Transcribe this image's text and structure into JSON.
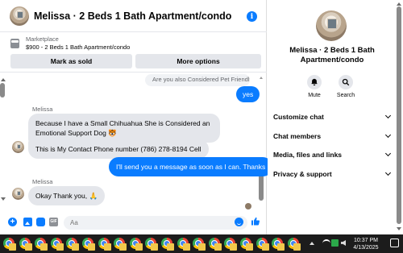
{
  "header": {
    "title": "Melissa · 2 Beds 1 Bath Apartment/condo",
    "info_icon_glyph": "i"
  },
  "marketplace": {
    "label": "Marketplace",
    "item": "$900 - 2 Beds 1 Bath Apartment/condo",
    "mark_sold_label": "Mark as sold",
    "more_options_label": "More options"
  },
  "messages": {
    "reply_preview": "Are you also Considered Pet Friendly ?...",
    "yes": "yes",
    "sender_1": "Melissa",
    "msg_chihuahua": "Because I have a Small Chihuahua She is Considered an Emotional Support Dog 🐯",
    "msg_phone": "This is My Contact Phone number (786) 278-8194 Cell",
    "msg_send": "I'll send you a message as soon as I can. Thanks",
    "sender_2": "Melissa",
    "msg_thanks": "Okay Thank you, 🙏"
  },
  "composer": {
    "placeholder": "Aa",
    "plus_glyph": "+",
    "gif_label": "GIF"
  },
  "sidebar": {
    "title": "Melissa · 2 Beds 1 Bath Apartment/condo",
    "mute_label": "Mute",
    "search_label": "Search",
    "menu": [
      "Customize chat",
      "Chat members",
      "Media, files and links",
      "Privacy & support"
    ]
  },
  "taskbar": {
    "time": "10:37 PM",
    "date": "4/13/2025",
    "app_count": 19
  },
  "colors": {
    "accent": "#0a7cff",
    "bubble_in": "#e4e6eb",
    "taskbar": "#1c1c1c"
  },
  "icons": {
    "info": "info-icon",
    "marketplace": "marketplace-icon",
    "mute": "bell-icon",
    "search": "search-icon",
    "like": "thumbs-up-icon",
    "emoji": "emoji-icon",
    "app": "chrome-icon"
  }
}
